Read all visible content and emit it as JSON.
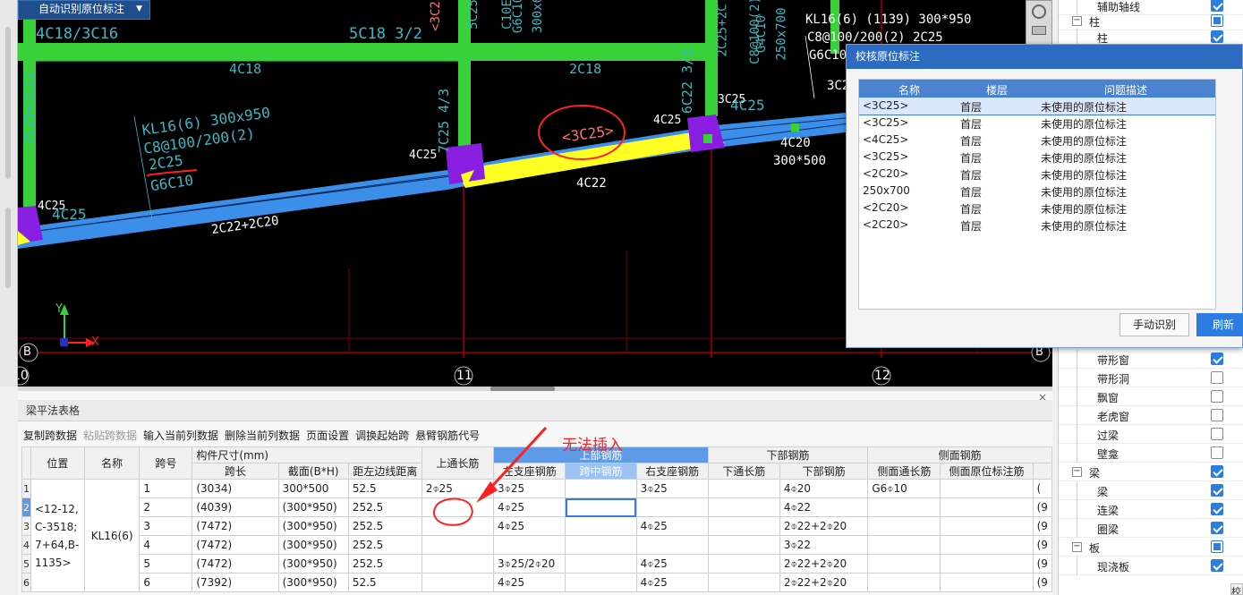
{
  "toolbar": {
    "auto_identify_label": "自动识别原位标注"
  },
  "cad": {
    "labels": {
      "t1": "4C18/3C16",
      "t2": "5C18 3/2",
      "t3": "4C18",
      "t4": "2C18",
      "t5": "2C25+3C22",
      "t6": "KL16(6) 300x950",
      "t7": "C8@100/200(2)",
      "t8": "2C25",
      "t9": "G6C10",
      "t10": "4C25",
      "t11": "4C25",
      "t12": "4C25",
      "t13": "4C25",
      "t14": "<3C25>",
      "t15": "4C22",
      "t16": "3C25",
      "t17": "4C25",
      "t18": "4C20",
      "t19": "300*500",
      "t20": "2C22+2C20",
      "t21": "7C25 4/3",
      "t22": "6C22 3/3",
      "t23": "KL16(6) (1139) 300*950",
      "t24": "C8@100/200(2) 2C25",
      "t25": "G6C10",
      "t26": "3C2",
      "t27": "250x700",
      "t28": "5C25",
      "t29": "G6C10",
      "t30": "2C25+2C",
      "t31": "C8@100(2)",
      "t32": "G4C10",
      "t33": "C10E",
      "t34": "300x6",
      "t35": "<3C2"
    },
    "axis": {
      "y": "Y",
      "x": "X",
      "b_left": "B",
      "b_right": "B",
      "g10": "10",
      "g11": "11",
      "g12": "12"
    },
    "annotation": "无法插入"
  },
  "dialog": {
    "title": "校核原位标注",
    "columns": [
      "名称",
      "楼层",
      "问题描述"
    ],
    "rows": [
      {
        "name": "<3C25>",
        "floor": "首层",
        "desc": "未使用的原位标注"
      },
      {
        "name": "<3C25>",
        "floor": "首层",
        "desc": "未使用的原位标注"
      },
      {
        "name": "<4C25>",
        "floor": "首层",
        "desc": "未使用的原位标注"
      },
      {
        "name": "<3C25>",
        "floor": "首层",
        "desc": "未使用的原位标注"
      },
      {
        "name": "<2C20>",
        "floor": "首层",
        "desc": "未使用的原位标注"
      },
      {
        "name": "250x700",
        "floor": "首层",
        "desc": "未使用的原位标注"
      },
      {
        "name": "<2C20>",
        "floor": "首层",
        "desc": "未使用的原位标注"
      },
      {
        "name": "<2C20>",
        "floor": "首层",
        "desc": "未使用的原位标注"
      }
    ],
    "btn_manual": "手动识别",
    "btn_refresh": "刷新"
  },
  "tree": {
    "items": [
      {
        "label": "辅助轴线",
        "checked": true
      },
      {
        "label": "柱",
        "group": true,
        "expander": "−",
        "partial": true
      },
      {
        "label": "柱",
        "checked": true
      },
      {
        "label": "带形窗",
        "checked": true
      },
      {
        "label": "带形洞",
        "checked": false
      },
      {
        "label": "飘窗",
        "checked": false
      },
      {
        "label": "老虎窗",
        "checked": false
      },
      {
        "label": "过梁",
        "checked": false
      },
      {
        "label": "壁龛",
        "checked": false
      },
      {
        "label": "梁",
        "group": true,
        "expander": "−",
        "checked": true
      },
      {
        "label": "梁",
        "checked": true
      },
      {
        "label": "连梁",
        "checked": true
      },
      {
        "label": "圈梁",
        "checked": true
      },
      {
        "label": "板",
        "group": true,
        "expander": "−",
        "partial": true
      },
      {
        "label": "现浇板",
        "checked": true
      }
    ],
    "bottom_stub": "校"
  },
  "grid": {
    "title": "梁平法表格",
    "close": "×",
    "tools": [
      {
        "label": "复制跨数据",
        "disabled": false
      },
      {
        "label": "粘贴跨数据",
        "disabled": true
      },
      {
        "label": "输入当前列数据",
        "disabled": false
      },
      {
        "label": "删除当前列数据",
        "disabled": false
      },
      {
        "label": "页面设置",
        "disabled": false
      },
      {
        "label": "调换起始跨",
        "disabled": false
      },
      {
        "label": "悬臂钢筋代号",
        "disabled": false
      }
    ],
    "headers": {
      "position": "位置",
      "name": "名称",
      "span_no": "跨号",
      "size_group": "构件尺寸(mm)",
      "span_len": "跨长",
      "section": "截面(B*H)",
      "edge_dist": "距左边线距离",
      "top_through": "上通长筋",
      "top_group": "上部钢筋",
      "left_support": "左支座钢筋",
      "mid_span": "跨中钢筋",
      "right_support": "右支座钢筋",
      "bottom_group": "下部钢筋",
      "bottom_through": "下通长筋",
      "bottom_bar": "下部钢筋",
      "side_group": "侧面钢筋",
      "side_through": "侧面通长筋",
      "side_note": "侧面原位标注筋"
    },
    "position_text": "<12-12,C-3518;7+64,B-1135>",
    "name_text": "KL16(6)",
    "rows": [
      {
        "rn": "1",
        "span": "1",
        "len": "(3034)",
        "sec": "300*500",
        "dist": "52.5",
        "top": "2⌽25",
        "left": "3⌽25",
        "mid": "",
        "right": "3⌽25",
        "bthru": "",
        "bottom": "4⌽20",
        "side": "G6⌽10",
        "note": "",
        "x": "("
      },
      {
        "rn": "2",
        "span": "2",
        "len": "(4039)",
        "sec": "(300*950)",
        "dist": "252.5",
        "top": "",
        "left": "4⌽25",
        "mid": "",
        "right": "",
        "bthru": "",
        "bottom": "4⌽22",
        "side": "",
        "note": "",
        "x": "(9"
      },
      {
        "rn": "3",
        "span": "3",
        "len": "(7472)",
        "sec": "(300*950)",
        "dist": "252.5",
        "top": "",
        "left": "4⌽25",
        "mid": "",
        "right": "4⌽25",
        "bthru": "",
        "bottom": "2⌽22+2⌽20",
        "side": "",
        "note": "",
        "x": "(9"
      },
      {
        "rn": "4",
        "span": "4",
        "len": "(7472)",
        "sec": "(300*950)",
        "dist": "252.5",
        "top": "",
        "left": "",
        "mid": "",
        "right": "",
        "bthru": "",
        "bottom": "3⌽22",
        "side": "",
        "note": "",
        "x": "(9"
      },
      {
        "rn": "5",
        "span": "5",
        "len": "(7472)",
        "sec": "(300*950)",
        "dist": "252.5",
        "top": "",
        "left": "3⌽25/2⌽20",
        "mid": "",
        "right": "4⌽25",
        "bthru": "",
        "bottom": "2⌽22+2⌽20",
        "side": "",
        "note": "",
        "x": "(9"
      },
      {
        "rn": "6",
        "span": "6",
        "len": "(7392)",
        "sec": "(300*950)",
        "dist": "52.5",
        "top": "",
        "left": "4⌽25",
        "mid": "",
        "right": "4⌽25",
        "bthru": "",
        "bottom": "2⌽22+2⌽20",
        "side": "",
        "note": "",
        "x": "(9"
      }
    ]
  }
}
